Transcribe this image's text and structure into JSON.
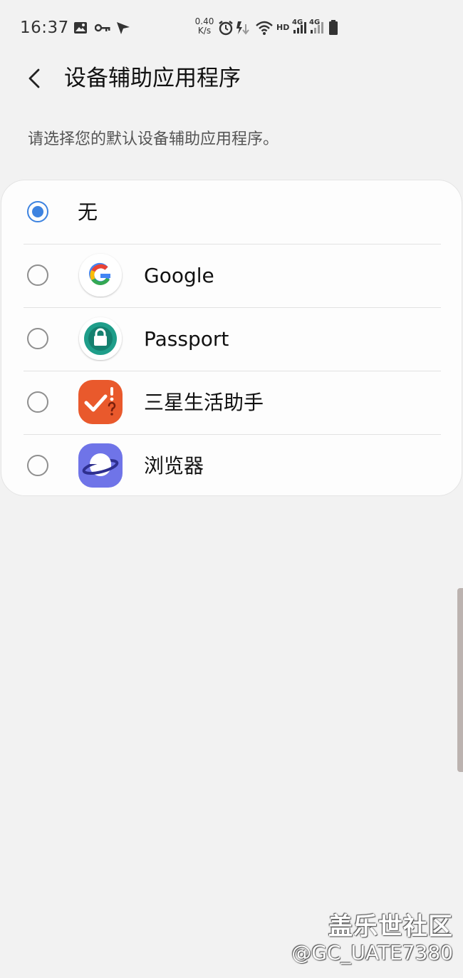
{
  "status_bar": {
    "time": "16:37",
    "net_speed_value": "0.40",
    "net_speed_unit": "K/s",
    "hd_label": "HD",
    "sim1_label": "4G",
    "sim2_label": "4G",
    "icons": [
      "gallery-icon",
      "vpn-key-icon",
      "send-icon",
      "alarm-icon",
      "data-arrows-icon",
      "wifi-icon",
      "signal-icon",
      "signal-icon",
      "battery-icon"
    ]
  },
  "header": {
    "title": "设备辅助应用程序",
    "back_icon": "chevron-left-icon"
  },
  "description": "请选择您的默认设备辅助应用程序。",
  "options": [
    {
      "label": "无",
      "selected": true,
      "icon": null
    },
    {
      "label": "Google",
      "selected": false,
      "icon": "google-icon"
    },
    {
      "label": "Passport",
      "selected": false,
      "icon": "passport-lock-icon"
    },
    {
      "label": "三星生活助手",
      "selected": false,
      "icon": "samsung-life-assistant-icon"
    },
    {
      "label": "浏览器",
      "selected": false,
      "icon": "browser-planet-icon"
    }
  ],
  "colors": {
    "accent": "#3d83e0",
    "background": "#f2f2f2",
    "card": "#fdfdfd"
  },
  "watermark": {
    "line1": "盖乐世社区",
    "line2": "@GC_UATE7380"
  }
}
